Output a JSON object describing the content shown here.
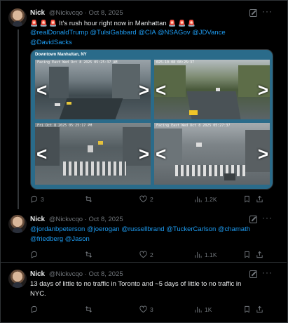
{
  "tweets": [
    {
      "name": "Nick",
      "handle": "@Nickvcqo · Oct 8, 2025",
      "text": "It's rush hour right now in Manhattan",
      "sirens": "🚨 🚨 🚨",
      "mentions_line1": "@realDonaldTrump @TulsiGabbard @CIA @NSAGov @JDVance",
      "mentions_line2": "@DavidSacks",
      "replies": "3",
      "reposts": "",
      "likes": "2",
      "views": "1.2K"
    },
    {
      "name": "Nick",
      "handle": "@Nickvcqo · Oct 8, 2025",
      "mentions_line1": "@jordanbpeterson @joerogan @russellbrand @TuckerCarlson @chamath",
      "mentions_line2": "@friedberg @Jason",
      "replies": "",
      "reposts": "",
      "likes": "2",
      "views": "1.1K"
    },
    {
      "name": "Nick",
      "handle": "@Nickvcqo · Oct 8, 2025",
      "text_line1": "13 days of little to no traffic in Toronto and ~5 days of little to no traffic in",
      "text_line2": "NYC.",
      "replies": "",
      "reposts": "",
      "likes": "3",
      "views": "1K"
    }
  ],
  "media": {
    "title": "Downtown Manhattan, NY",
    "cams": [
      {
        "stamp": "Facing East Wed Oct 8 2025 05:25:37 AM"
      },
      {
        "stamp": "025-10-08 08:25:37"
      },
      {
        "stamp": "Fri Oct 8 2025 05:25:17 PM"
      },
      {
        "stamp": "Facing East Wed Oct 8 2025 05:27:37"
      }
    ]
  },
  "icons": {
    "more": "more-icon",
    "grok": "grok-icon",
    "reply": "reply-icon",
    "repost": "repost-icon",
    "like": "like-icon",
    "views": "views-icon",
    "bookmark": "bookmark-icon",
    "share": "share-icon"
  },
  "colors": {
    "accent": "#1d9bf0",
    "muted": "#71767b",
    "background": "#000000",
    "siren": "#f4212e"
  }
}
